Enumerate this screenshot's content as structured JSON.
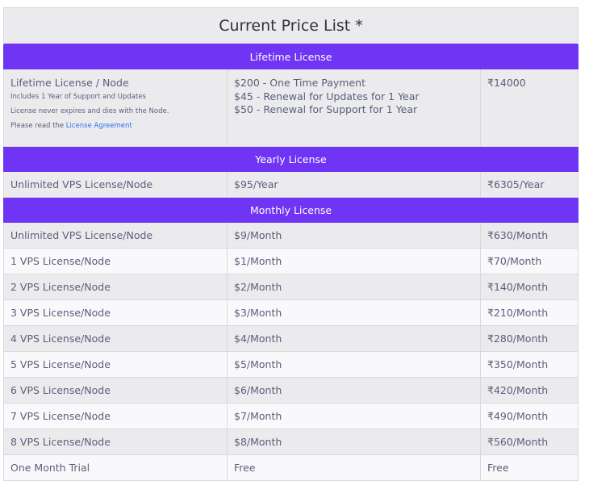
{
  "title": "Current Price List *",
  "sections": {
    "lifetime": {
      "heading": "Lifetime License",
      "name": "Lifetime License / Node",
      "notes": [
        "Includes 1 Year of Support and Updates",
        "License never expires and dies with the Node."
      ],
      "read_prefix": "Please read the ",
      "read_link": "License Agreement",
      "prices": [
        "$200 - One Time Payment",
        "$45 - Renewal for Updates for 1 Year",
        "$50 - Renewal for Support for 1 Year"
      ],
      "inr": "₹14000"
    },
    "yearly": {
      "heading": "Yearly License",
      "rows": [
        {
          "name": "Unlimited VPS License/Node",
          "usd": "$95/Year",
          "inr": "₹6305/Year"
        }
      ]
    },
    "monthly": {
      "heading": "Monthly License",
      "rows": [
        {
          "name": "Unlimited VPS License/Node",
          "usd": "$9/Month",
          "inr": "₹630/Month"
        },
        {
          "name": "1 VPS License/Node",
          "usd": "$1/Month",
          "inr": "₹70/Month"
        },
        {
          "name": "2 VPS License/Node",
          "usd": "$2/Month",
          "inr": "₹140/Month"
        },
        {
          "name": "3 VPS License/Node",
          "usd": "$3/Month",
          "inr": "₹210/Month"
        },
        {
          "name": "4 VPS License/Node",
          "usd": "$4/Month",
          "inr": "₹280/Month"
        },
        {
          "name": "5 VPS License/Node",
          "usd": "$5/Month",
          "inr": "₹350/Month"
        },
        {
          "name": "6 VPS License/Node",
          "usd": "$6/Month",
          "inr": "₹420/Month"
        },
        {
          "name": "7 VPS License/Node",
          "usd": "$7/Month",
          "inr": "₹490/Month"
        },
        {
          "name": "8 VPS License/Node",
          "usd": "$8/Month",
          "inr": "₹560/Month"
        },
        {
          "name": "One Month Trial",
          "usd": "Free",
          "inr": "Free"
        }
      ]
    }
  },
  "colors": {
    "section_header": "#7034f4",
    "row_grey": "#ebebed",
    "row_white": "#f9f9fb",
    "link": "#2b6ff3"
  }
}
